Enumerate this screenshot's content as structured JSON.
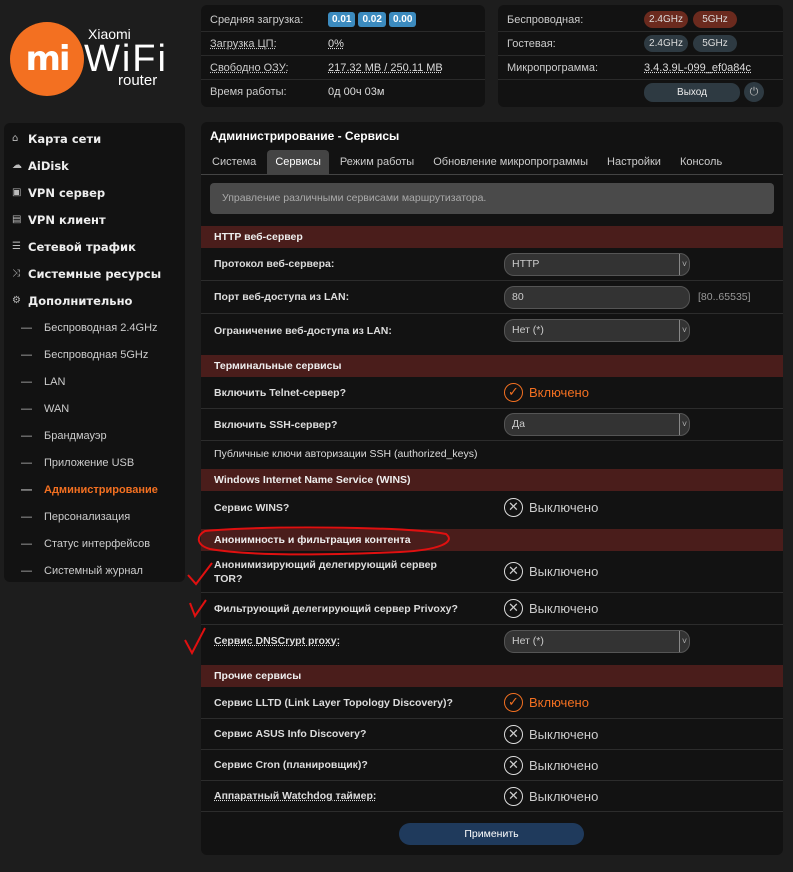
{
  "logo": {
    "mark": "mi",
    "brand": "Xiaomi",
    "product": "WiFi",
    "sub": "router"
  },
  "status": {
    "load_label": "Средняя загрузка:",
    "load": [
      "0.01",
      "0.02",
      "0.00"
    ],
    "cpu_label": "Загрузка ЦП:",
    "cpu": "0%",
    "ram_label": "Свободно ОЗУ:",
    "ram": "217.32 MB / 250.11 MB",
    "uptime_label": "Время работы:",
    "uptime": "0д 00ч 03м"
  },
  "wireless": {
    "wireless_label": "Беспроводная:",
    "guest_label": "Гостевая:",
    "fw_label": "Микропрограмма:",
    "band24": "2.4GHz",
    "band5": "5GHz",
    "firmware": "3.4.3.9L-099_ef0a84c",
    "logout": "Выход"
  },
  "sidebar": {
    "items": [
      {
        "label": "Карта сети",
        "icon": "home-icon"
      },
      {
        "label": "AiDisk",
        "icon": "cloud-icon"
      },
      {
        "label": "VPN сервер",
        "icon": "vpn-server-icon"
      },
      {
        "label": "VPN клиент",
        "icon": "vpn-client-icon"
      },
      {
        "label": "Сетевой трафик",
        "icon": "traffic-icon"
      },
      {
        "label": "Системные ресурсы",
        "icon": "shuffle-icon"
      },
      {
        "label": "Дополнительно",
        "icon": "gear-icon"
      }
    ],
    "sub": [
      "Беспроводная 2.4GHz",
      "Беспроводная 5GHz",
      "LAN",
      "WAN",
      "Брандмауэр",
      "Приложение USB",
      "Администрирование",
      "Персонализация",
      "Статус интерфейсов",
      "Системный журнал"
    ]
  },
  "main": {
    "title": "Администрирование - Сервисы",
    "tabs": [
      "Система",
      "Сервисы",
      "Режим работы",
      "Обновление микропрограммы",
      "Настройки",
      "Консоль"
    ],
    "info": "Управление различными сервисами маршрутизатора.",
    "http": {
      "header": "HTTP веб-сервер",
      "proto_label": "Протокол веб-сервера:",
      "proto": "HTTP",
      "port_label": "Порт веб-доступа из LAN:",
      "port": "80",
      "port_hint": "[80..65535]",
      "restrict_label": "Ограничение веб-доступа из LAN:",
      "restrict": "Нет (*)"
    },
    "term": {
      "header": "Терминальные сервисы",
      "telnet_label": "Включить Telnet-сервер?",
      "telnet": "Включено",
      "ssh_label": "Включить SSH-сервер?",
      "ssh": "Да",
      "keys_label": "Публичные ключи авторизации SSH (authorized_keys)"
    },
    "wins": {
      "header": "Windows Internet Name Service (WINS)",
      "wins_label": "Сервис WINS?",
      "wins": "Выключено"
    },
    "anon": {
      "header": "Анонимность и фильтрация контента",
      "tor_label": "Анонимизирующий делегирующий сервер TOR?",
      "tor": "Выключено",
      "privoxy_label": "Фильтрующий делегирующий сервер Privoxy?",
      "privoxy": "Выключено",
      "dnscrypt_label": "Сервис DNSCrypt proxy:",
      "dnscrypt": "Нет (*)"
    },
    "other": {
      "header": "Прочие сервисы",
      "lltd_label": "Сервис LLTD (Link Layer Topology Discovery)?",
      "lltd": "Включено",
      "asus_label": "Сервис ASUS Info Discovery?",
      "asus": "Выключено",
      "cron_label": "Сервис Cron (планировщик)?",
      "cron": "Выключено",
      "wd_label": "Аппаратный Watchdog таймер:",
      "wd": "Выключено"
    },
    "apply": "Применить"
  },
  "colors": {
    "accent": "#f37021",
    "section": "#4a1d1b",
    "annotation": "#e01010"
  }
}
